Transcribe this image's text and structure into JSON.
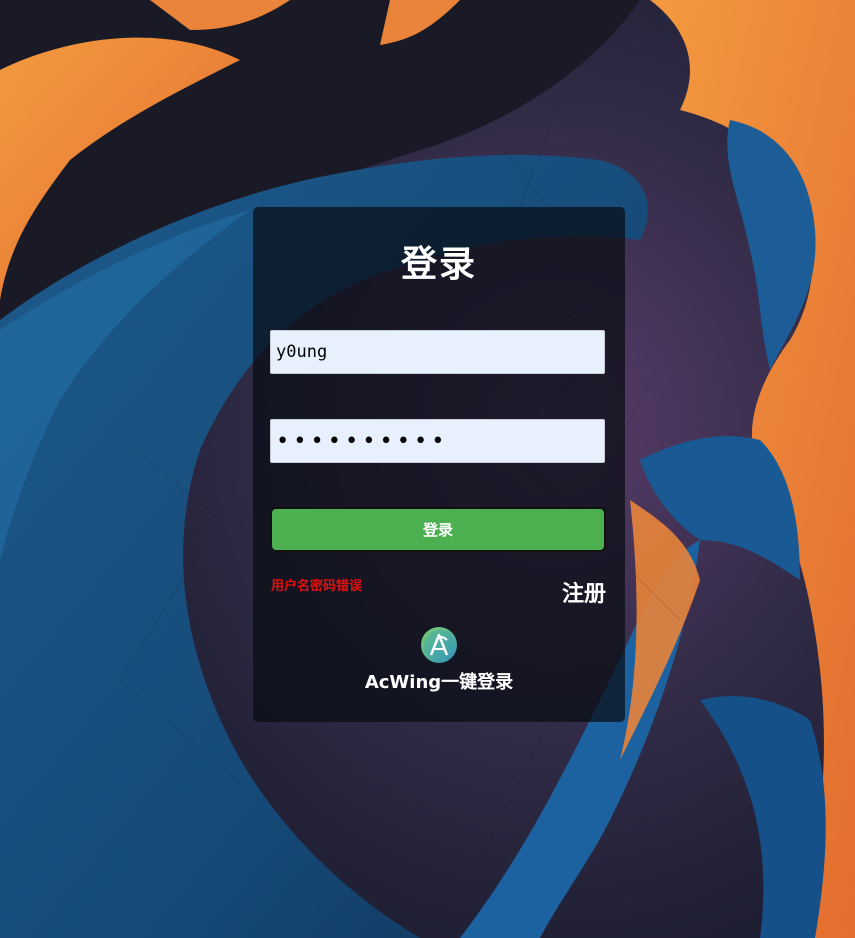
{
  "login": {
    "title": "登录",
    "username_value": "y0ung",
    "password_mask": "••••••••••",
    "submit_label": "登录",
    "error_text": "用户名密码错误",
    "register_label": "注册",
    "acwing_label": "AcWing一键登录"
  },
  "icons": {
    "acwing_logo": "acwing-logo-icon"
  },
  "colors": {
    "submit_button": "#4caf50",
    "error_text": "#e01010",
    "input_background": "#e8f0fe",
    "card_background": "rgba(8,12,20,0.72)"
  }
}
